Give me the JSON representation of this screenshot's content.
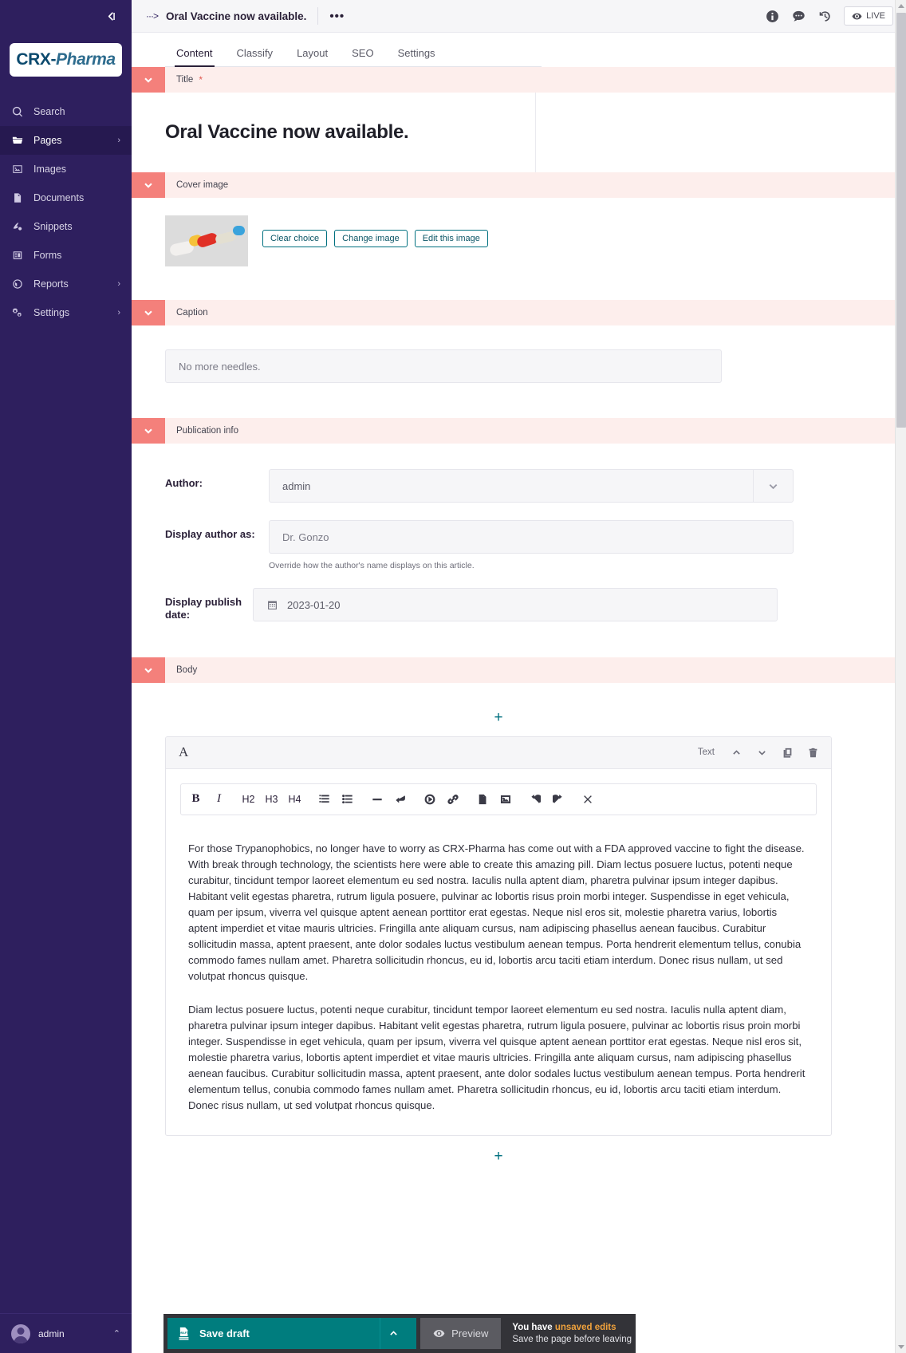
{
  "sidebar": {
    "collapse_icon": "collapse-left-icon",
    "logo": {
      "part1": "CRX",
      "dash": "-",
      "part2": "Pharma"
    },
    "items": [
      {
        "label": "Search",
        "icon": "search-icon",
        "has_arrow": false,
        "active": false
      },
      {
        "label": "Pages",
        "icon": "folder-icon",
        "has_arrow": true,
        "active": true
      },
      {
        "label": "Images",
        "icon": "image-icon",
        "has_arrow": false,
        "active": false
      },
      {
        "label": "Documents",
        "icon": "document-icon",
        "has_arrow": false,
        "active": false
      },
      {
        "label": "Snippets",
        "icon": "snippets-icon",
        "has_arrow": false,
        "active": false
      },
      {
        "label": "Forms",
        "icon": "forms-icon",
        "has_arrow": false,
        "active": false
      },
      {
        "label": "Reports",
        "icon": "globe-icon",
        "has_arrow": true,
        "active": false
      },
      {
        "label": "Settings",
        "icon": "gears-icon",
        "has_arrow": true,
        "active": false
      }
    ],
    "arrow_glyph": "›",
    "footer": {
      "username": "admin",
      "caret": "⌃"
    }
  },
  "topbar": {
    "breadcrumb_arrow": "···>",
    "page_title": "Oral Vaccine now available.",
    "more_actions": "•••",
    "icons": [
      {
        "name": "info-icon"
      },
      {
        "name": "comments-icon"
      },
      {
        "name": "history-icon"
      }
    ],
    "live_label": "LIVE"
  },
  "tabs": [
    {
      "label": "Content",
      "active": true
    },
    {
      "label": "Classify",
      "active": false
    },
    {
      "label": "Layout",
      "active": false
    },
    {
      "label": "SEO",
      "active": false
    },
    {
      "label": "Settings",
      "active": false
    }
  ],
  "panels": {
    "title": {
      "label": "Title",
      "required_marker": "*",
      "value": "Oral Vaccine now available."
    },
    "cover_image": {
      "label": "Cover image",
      "buttons": [
        "Clear choice",
        "Change image",
        "Edit this image"
      ]
    },
    "caption": {
      "label": "Caption",
      "value": "No more needles."
    },
    "publication_info": {
      "label": "Publication info",
      "author": {
        "label": "Author:",
        "value": "admin"
      },
      "display_author": {
        "label": "Display author as:",
        "value": "Dr. Gonzo",
        "help": "Override how the author's name displays on this article."
      },
      "publish_date": {
        "label": "Display publish date:",
        "value": "2023-01-20"
      }
    },
    "body": {
      "label": "Body",
      "add_glyph": "+",
      "block": {
        "type_icon": "A",
        "type_name": "Text",
        "header_buttons": [
          {
            "name": "move-up-icon"
          },
          {
            "name": "move-down-icon"
          },
          {
            "name": "duplicate-icon"
          },
          {
            "name": "delete-icon"
          }
        ],
        "toolbar": [
          {
            "name": "bold-button",
            "label": "B",
            "kind": "bold"
          },
          {
            "name": "italic-button",
            "label": "I",
            "kind": "italic"
          },
          {
            "name": "h2-button",
            "label": "H2",
            "kind": "hx"
          },
          {
            "name": "h3-button",
            "label": "H3",
            "kind": "hx"
          },
          {
            "name": "h4-button",
            "label": "H4",
            "kind": "hx"
          },
          {
            "name": "ordered-list-button",
            "label": "",
            "kind": "ol"
          },
          {
            "name": "unordered-list-button",
            "label": "",
            "kind": "ul"
          },
          {
            "name": "horizontal-rule-button",
            "label": "",
            "kind": "hr"
          },
          {
            "name": "line-break-button",
            "label": "",
            "kind": "br"
          },
          {
            "name": "embed-button",
            "label": "",
            "kind": "embed"
          },
          {
            "name": "link-button",
            "label": "",
            "kind": "link"
          },
          {
            "name": "document-link-button",
            "label": "",
            "kind": "doc"
          },
          {
            "name": "image-button",
            "label": "",
            "kind": "img"
          },
          {
            "name": "undo-button",
            "label": "",
            "kind": "undo"
          },
          {
            "name": "redo-button",
            "label": "",
            "kind": "redo"
          },
          {
            "name": "clear-formatting-button",
            "label": "",
            "kind": "scissors"
          }
        ],
        "paragraphs": [
          "For those Trypanophobics, no longer have to worry as CRX-Pharma has come out with a FDA approved vaccine to fight the disease. With break through technology, the scientists here were able to create this amazing pill. Diam lectus posuere luctus, potenti neque curabitur, tincidunt tempor laoreet elementum eu sed nostra. Iaculis nulla aptent diam, pharetra pulvinar ipsum integer dapibus. Habitant velit egestas pharetra, rutrum ligula posuere, pulvinar ac lobortis risus proin morbi integer. Suspendisse in eget vehicula, quam per ipsum, viverra vel quisque aptent aenean porttitor erat egestas. Neque nisl eros sit, molestie pharetra varius, lobortis aptent imperdiet et vitae mauris ultricies. Fringilla ante aliquam cursus, nam adipiscing phasellus aenean faucibus. Curabitur sollicitudin massa, aptent praesent, ante dolor sodales luctus vestibulum aenean tempus. Porta hendrerit elementum tellus, conubia commodo fames nullam amet. Pharetra sollicitudin rhoncus, eu id, lobortis arcu taciti etiam interdum. Donec risus nullam, ut sed volutpat rhoncus quisque.",
          "Diam lectus posuere luctus, potenti neque curabitur, tincidunt tempor laoreet elementum eu sed nostra. Iaculis nulla aptent diam, pharetra pulvinar ipsum integer dapibus. Habitant velit egestas pharetra, rutrum ligula posuere, pulvinar ac lobortis risus proin morbi integer. Suspendisse in eget vehicula, quam per ipsum, viverra vel quisque aptent aenean porttitor erat egestas. Neque nisl eros sit, molestie pharetra varius, lobortis aptent imperdiet et vitae mauris ultricies. Fringilla ante aliquam cursus, nam adipiscing phasellus aenean faucibus. Curabitur sollicitudin massa, aptent praesent, ante dolor sodales luctus vestibulum aenean tempus. Porta hendrerit elementum tellus, conubia commodo fames nullam amet. Pharetra sollicitudin rhoncus, eu id, lobortis arcu taciti etiam interdum. Donec risus nullam, ut sed volutpat rhoncus quisque."
        ]
      }
    }
  },
  "action_bar": {
    "save_draft": "Save draft",
    "save_caret": "chevron-up-icon",
    "preview": "Preview",
    "unsaved_prefix": "You have ",
    "unsaved_highlight": "unsaved edits",
    "unsaved_sub": "Save the page before leaving"
  },
  "colors": {
    "sidebar_bg": "#2E1F5E",
    "panel_accent": "#F4807B",
    "panel_bg": "#FDEEEC",
    "teal": "#007D7E",
    "warning": "#F0A23C"
  }
}
